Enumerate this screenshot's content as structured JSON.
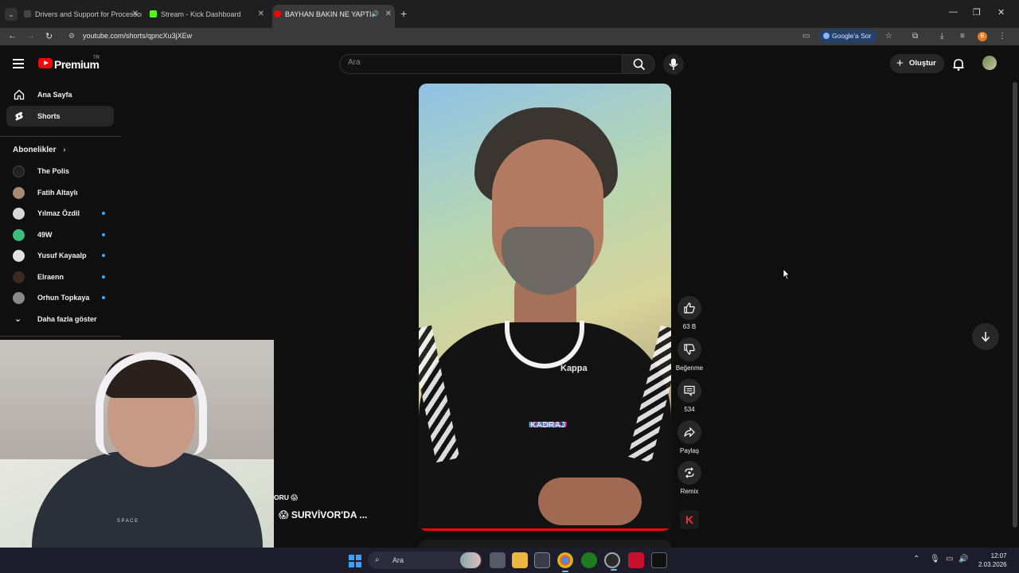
{
  "browser": {
    "tabs": [
      {
        "title": "Drivers and Support for Processors",
        "favicon_color": "#444444"
      },
      {
        "title": "Stream - Kick Dashboard",
        "favicon_color": "#53fc18"
      },
      {
        "title": "BAYHAN BAKIN NE YAPTI",
        "favicon_color": "#ff0000"
      }
    ],
    "url": "youtube.com/shorts/qpncXu3jXEw",
    "ask_google": "Google'a Sor",
    "profile_initial": "B"
  },
  "youtube": {
    "brand": "Premium",
    "region": "TR",
    "search_placeholder": "Ara",
    "create_label": "Oluştur"
  },
  "sidebar": {
    "nav": [
      {
        "label": "Ana Sayfa",
        "icon": "home-icon"
      },
      {
        "label": "Shorts",
        "icon": "shorts-icon",
        "active": true
      }
    ],
    "subscriptions_title": "Abonelikler",
    "subscriptions": [
      {
        "name": "The Polis",
        "color": "#222222",
        "new": false
      },
      {
        "name": "Fatih Altaylı",
        "color": "#a88a73",
        "new": false
      },
      {
        "name": "Yılmaz Özdil",
        "color": "#d8d8d8",
        "new": true
      },
      {
        "name": "49W",
        "color": "#3bbf7a",
        "new": true
      },
      {
        "name": "Yusuf Kayaalp",
        "color": "#e2e2e2",
        "new": true
      },
      {
        "name": "Elraenn",
        "color": "#3a2a22",
        "new": true
      },
      {
        "name": "Orhun Topkaya",
        "color": "#8a8a8a",
        "new": true
      }
    ],
    "show_more": "Daha fazla göster"
  },
  "short": {
    "shirt_brand": "Kappa",
    "watermark": "KADRAJ",
    "progress": 1.0,
    "overlay_line1": "ORU 😱",
    "overlay_line2": "😱 SURVİVOR'DA ..."
  },
  "actions": {
    "like_count": "63 B",
    "dislike_label": "Beğenme",
    "comment_count": "534",
    "share_label": "Paylaş",
    "remix_label": "Remix"
  },
  "taskbar": {
    "search_label": "Ara",
    "time": "12:07",
    "date": "2.03.2026"
  }
}
